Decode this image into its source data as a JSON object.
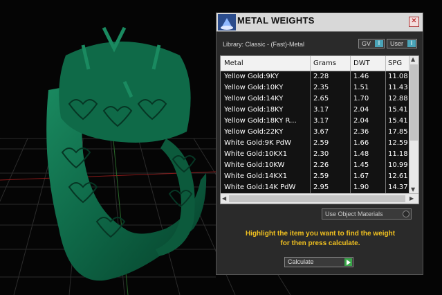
{
  "panel": {
    "title": "METAL WEIGHTS",
    "close_glyph": "✕",
    "library_label": "Library: Classic - (Fast)-Metal",
    "toggles": [
      {
        "label": "GV",
        "indicator": "I"
      },
      {
        "label": "User",
        "indicator": "I"
      }
    ],
    "columns": [
      "Metal",
      "Grams",
      "DWT",
      "SPG"
    ],
    "rows": [
      {
        "metal": "Yellow Gold:9KY",
        "grams": "2.28",
        "dwt": "1.46",
        "spg": "11.08"
      },
      {
        "metal": "Yellow Gold:10KY",
        "grams": "2.35",
        "dwt": "1.51",
        "spg": "11.43"
      },
      {
        "metal": "Yellow Gold:14KY",
        "grams": "2.65",
        "dwt": "1.70",
        "spg": "12.88"
      },
      {
        "metal": "Yellow Gold:18KY",
        "grams": "3.17",
        "dwt": "2.04",
        "spg": "15.41"
      },
      {
        "metal": "Yellow Gold:18KY R...",
        "grams": "3.17",
        "dwt": "2.04",
        "spg": "15.41"
      },
      {
        "metal": "Yellow Gold:22KY",
        "grams": "3.67",
        "dwt": "2.36",
        "spg": "17.85"
      },
      {
        "metal": "White Gold:9K PdW",
        "grams": "2.59",
        "dwt": "1.66",
        "spg": "12.59"
      },
      {
        "metal": "White Gold:10KX1",
        "grams": "2.30",
        "dwt": "1.48",
        "spg": "11.18"
      },
      {
        "metal": "White Gold:10KW",
        "grams": "2.26",
        "dwt": "1.45",
        "spg": "10.99"
      },
      {
        "metal": "White Gold:14KX1",
        "grams": "2.59",
        "dwt": "1.67",
        "spg": "12.61"
      },
      {
        "metal": "White Gold:14K PdW",
        "grams": "2.95",
        "dwt": "1.90",
        "spg": "14.37"
      }
    ],
    "object_materials_label": "Use Object Materials",
    "hint_line1": "Highlight the item you want to find the weight",
    "hint_line2": "for then press calculate.",
    "calculate_label": "Calculate",
    "colors": {
      "row_dark": "#121212",
      "hint": "#f0c020",
      "ring": "#0f6a48",
      "accent": "#4aa4b8"
    }
  }
}
